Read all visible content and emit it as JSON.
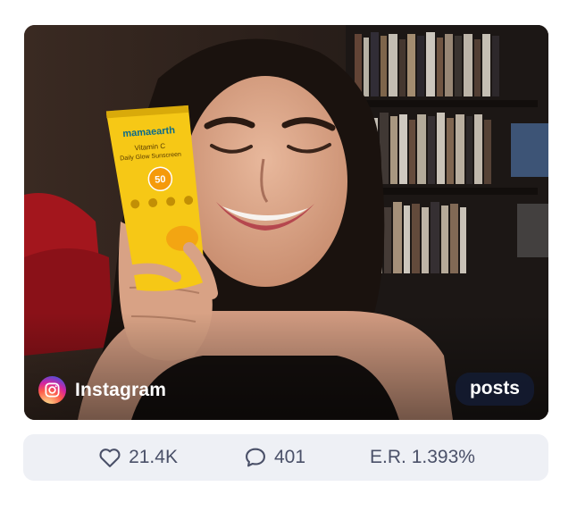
{
  "post": {
    "platform": "Instagram",
    "type": "posts",
    "product": {
      "brand": "mamaearth",
      "line1": "Vitamin C",
      "line2": "Daily Glow Sunscreen",
      "spf": "50"
    }
  },
  "stats": {
    "likes": "21.4K",
    "comments": "401",
    "engagement": "E.R. 1.393%"
  },
  "colors": {
    "stats_background": "#eef0f5",
    "stats_text": "#4a5068",
    "badge_background": "#141c34",
    "tube_yellow": "#f6c816"
  },
  "icons": {
    "likes": "heart-icon",
    "comments": "comment-icon",
    "platform": "instagram-icon"
  }
}
